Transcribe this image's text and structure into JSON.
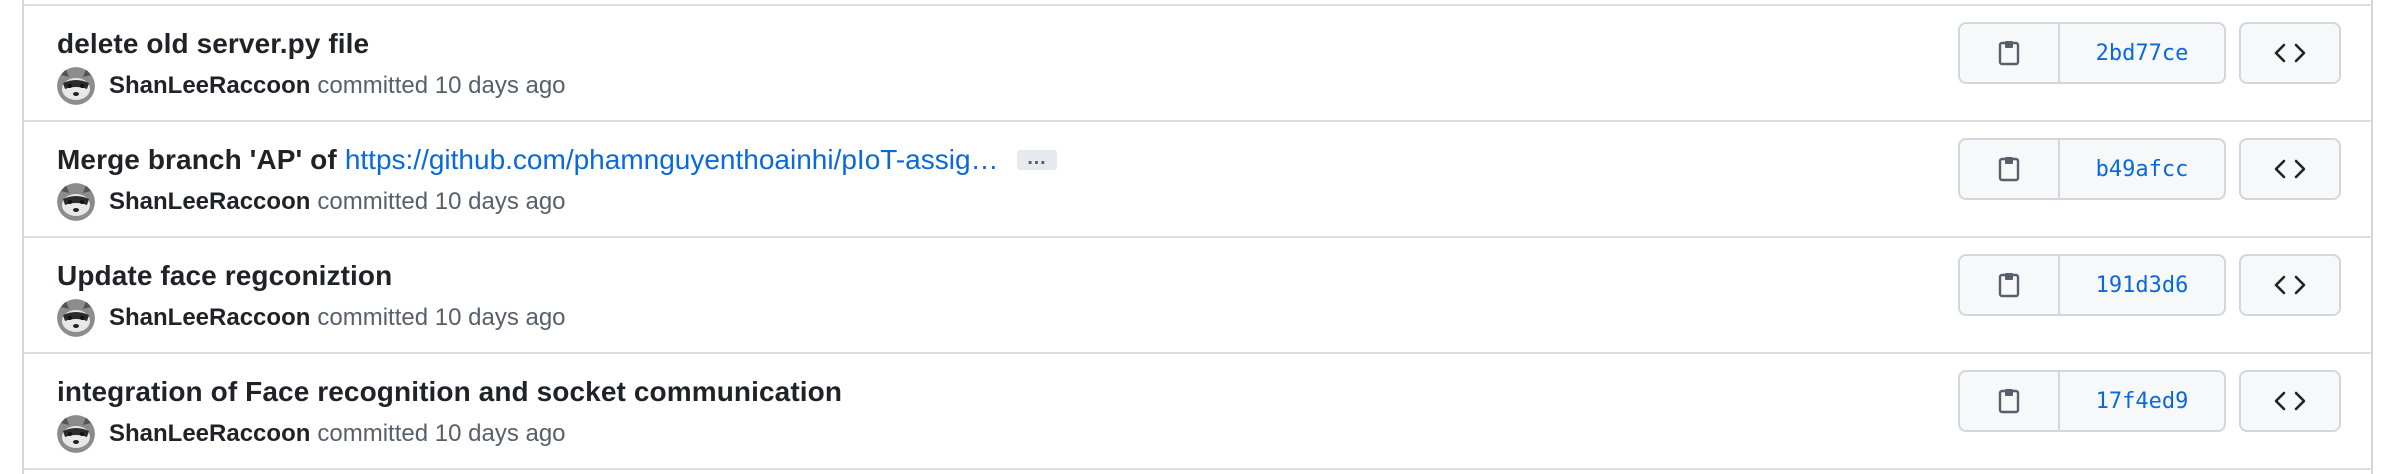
{
  "commits": [
    {
      "title": "delete old server.py file",
      "link": "",
      "has_ellipsis": false,
      "author": "ShanLeeRaccoon",
      "committed_text": "committed 10 days ago",
      "sha": "2bd77ce"
    },
    {
      "title": "Merge branch 'AP' of",
      "link": "https://github.com/phamnguyenthoainhi/pIoT-assig…",
      "has_ellipsis": true,
      "ellipsis_label": "…",
      "author": "ShanLeeRaccoon",
      "committed_text": "committed 10 days ago",
      "sha": "b49afcc"
    },
    {
      "title": "Update face regconiztion",
      "link": "",
      "has_ellipsis": false,
      "author": "ShanLeeRaccoon",
      "committed_text": "committed 10 days ago",
      "sha": "191d3d6"
    },
    {
      "title": "integration of Face recognition and socket communication",
      "link": "",
      "has_ellipsis": false,
      "author": "ShanLeeRaccoon",
      "committed_text": "committed 10 days ago",
      "sha": "17f4ed9"
    }
  ],
  "icons": {
    "copy": "clipboard-icon",
    "browse": "code-icon",
    "avatar": "raccoon-avatar"
  },
  "colors": {
    "link": "#0969da",
    "sha": "#0969da",
    "border": "#d0d7de",
    "button_bg": "#f6f8fa",
    "muted": "#57606a"
  }
}
